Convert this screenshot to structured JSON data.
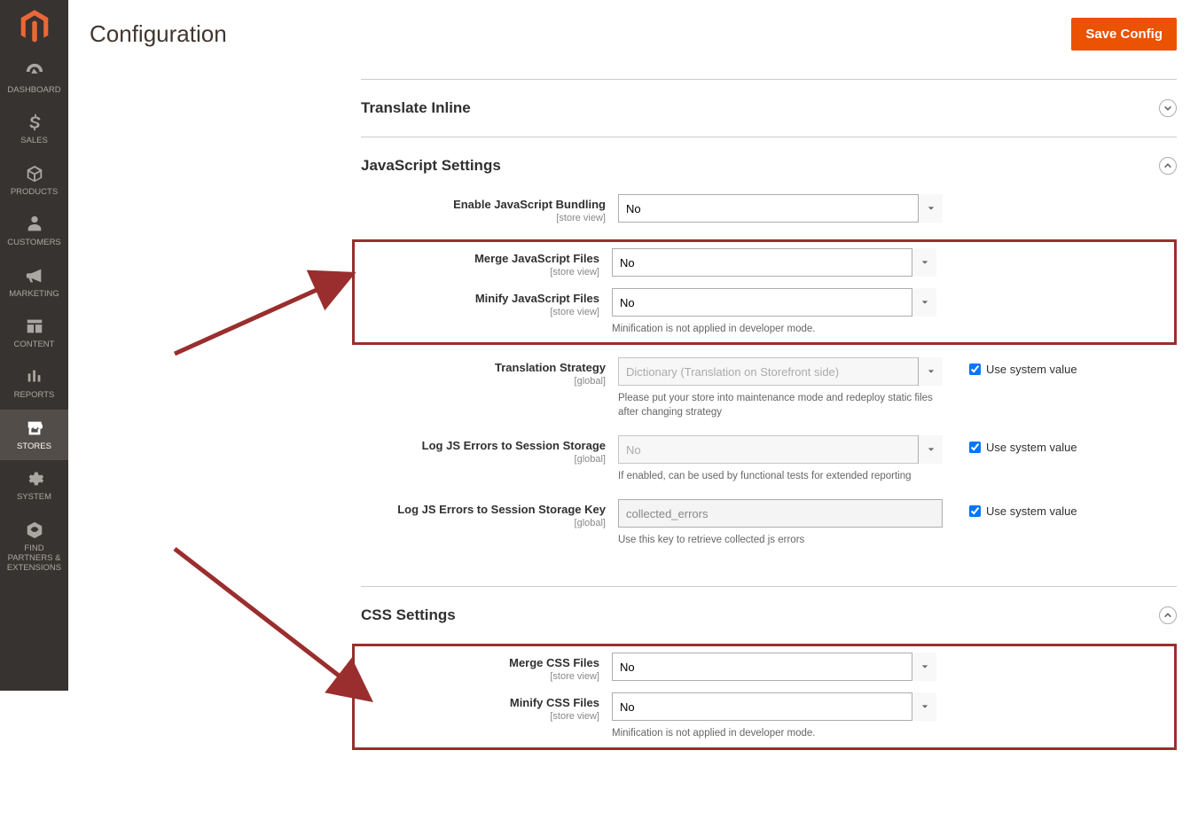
{
  "page": {
    "title": "Configuration",
    "save_button": "Save Config"
  },
  "sidebar": {
    "items": [
      {
        "label": "DASHBOARD"
      },
      {
        "label": "SALES"
      },
      {
        "label": "PRODUCTS"
      },
      {
        "label": "CUSTOMERS"
      },
      {
        "label": "MARKETING"
      },
      {
        "label": "CONTENT"
      },
      {
        "label": "REPORTS"
      },
      {
        "label": "STORES"
      },
      {
        "label": "SYSTEM"
      },
      {
        "label": "FIND PARTNERS & EXTENSIONS"
      }
    ]
  },
  "sections": {
    "translate": {
      "title": "Translate Inline"
    },
    "js": {
      "title": "JavaScript Settings",
      "fields": {
        "bundling": {
          "label": "Enable JavaScript Bundling",
          "scope": "[store view]",
          "value": "No"
        },
        "merge": {
          "label": "Merge JavaScript Files",
          "scope": "[store view]",
          "value": "No"
        },
        "minify": {
          "label": "Minify JavaScript Files",
          "scope": "[store view]",
          "value": "No",
          "note": "Minification is not applied in developer mode."
        },
        "translation": {
          "label": "Translation Strategy",
          "scope": "[global]",
          "value": "Dictionary (Translation on Storefront side)",
          "note": "Please put your store into maintenance mode and redeploy static files after changing strategy",
          "sysval": "Use system value"
        },
        "log_errors": {
          "label": "Log JS Errors to Session Storage",
          "scope": "[global]",
          "value": "No",
          "note": "If enabled, can be used by functional tests for extended reporting",
          "sysval": "Use system value"
        },
        "log_key": {
          "label": "Log JS Errors to Session Storage Key",
          "scope": "[global]",
          "value": "collected_errors",
          "note": "Use this key to retrieve collected js errors",
          "sysval": "Use system value"
        }
      }
    },
    "css": {
      "title": "CSS Settings",
      "fields": {
        "merge": {
          "label": "Merge CSS Files",
          "scope": "[store view]",
          "value": "No"
        },
        "minify": {
          "label": "Minify CSS Files",
          "scope": "[store view]",
          "value": "No",
          "note": "Minification is not applied in developer mode."
        }
      }
    }
  }
}
